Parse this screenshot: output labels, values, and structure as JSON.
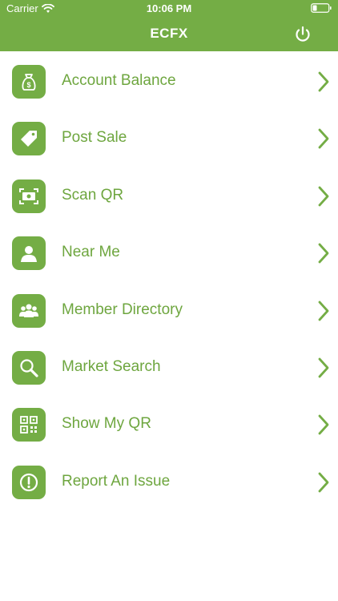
{
  "status_bar": {
    "carrier": "Carrier",
    "time": "10:06 PM"
  },
  "nav": {
    "title": "ECFX",
    "power_icon": "power-icon"
  },
  "colors": {
    "accent": "#74ad45",
    "text": "#6ea63f",
    "background": "#ffffff"
  },
  "menu": [
    {
      "label": "Account Balance",
      "icon": "money-bag-icon"
    },
    {
      "label": "Post Sale",
      "icon": "price-tag-icon"
    },
    {
      "label": "Scan QR",
      "icon": "scan-icon"
    },
    {
      "label": "Near Me",
      "icon": "person-icon"
    },
    {
      "label": "Member Directory",
      "icon": "group-icon"
    },
    {
      "label": "Market Search",
      "icon": "magnifier-icon"
    },
    {
      "label": "Show My QR",
      "icon": "qr-code-icon"
    },
    {
      "label": "Report An Issue",
      "icon": "alert-icon"
    }
  ]
}
